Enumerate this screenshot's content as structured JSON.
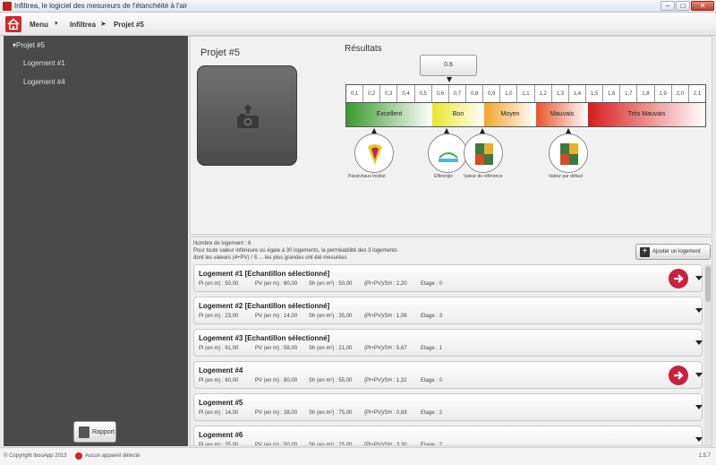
{
  "window": {
    "title": "Infiltrea, le logiciel des mesureurs de l'étanchéité à l'air",
    "btn_min": "–",
    "btn_max": "□",
    "btn_close": "✕"
  },
  "menubar": {
    "menu_label": "Menu",
    "menu_caret": "▾",
    "crumbs": [
      "Infiltrea",
      "Projet #5"
    ],
    "crumb_sep": "➤"
  },
  "sidebar": {
    "root": "▾Projet #5",
    "items": [
      "Logement #1",
      "Logement #4"
    ],
    "rapport_label": "Rapport"
  },
  "project": {
    "title": "Projet #5"
  },
  "results": {
    "title": "Résultats",
    "value": "0.6",
    "ticks": [
      "0,1",
      "0,2",
      "0,3",
      "0,4",
      "0,5",
      "0,6",
      "0,7",
      "0,8",
      "0,9",
      "1,0",
      "1,1",
      "1,2",
      "1,3",
      "1,4",
      "1,5",
      "1,6",
      "1,7",
      "1,8",
      "1,9",
      "2,0",
      "2,1"
    ],
    "zones": [
      {
        "label": "Excellent",
        "color": "#3a9a2e"
      },
      {
        "label": "Bon",
        "color": "#e9e52a"
      },
      {
        "label": "Moyen",
        "color": "#f2a52a"
      },
      {
        "label": "Mauvais",
        "color": "#e8552a"
      },
      {
        "label": "Très Mauvais",
        "color": "#d81c1c"
      }
    ],
    "badges": [
      {
        "label": "Passivhaus Institut"
      },
      {
        "label": "Effinergie"
      },
      {
        "label": "Valeur de référence"
      },
      {
        "label": "Valeur par défaut"
      }
    ]
  },
  "list": {
    "count_line": "Nombre de logement : 6",
    "info_line1": "Pour toute valeur inférieure ou égale à 30 logements, la perméabilité des 3 logements",
    "info_line2": "dont les valeurs (4+PV) / S ... les plus grandes ont été mesurées",
    "add_label": "Ajouter un logement",
    "field_labels": [
      "Pl (en m) :",
      "PV (en m) :",
      "Sh (en m²) :",
      "(Pl+PV)/SH :",
      "Etage :"
    ],
    "items": [
      {
        "name": "Logement #1 [Echantillon sélectionné]",
        "pl": "50,00",
        "pv": "60,00",
        "sh": "50,00",
        "ratio": "2,20",
        "etage": "0",
        "go": true
      },
      {
        "name": "Logement #2 [Echantillon sélectionné]",
        "pl": "23,00",
        "pv": "14,00",
        "sh": "35,00",
        "ratio": "1,06",
        "etage": "3",
        "go": false
      },
      {
        "name": "Logement #3 [Echantillon sélectionné]",
        "pl": "61,00",
        "pv": "58,00",
        "sh": "21,00",
        "ratio": "5,67",
        "etage": "1",
        "go": false
      },
      {
        "name": "Logement #4",
        "pl": "60,00",
        "pv": "80,00",
        "sh": "55,00",
        "ratio": "1,32",
        "etage": "0",
        "go": true
      },
      {
        "name": "Logement #5",
        "pl": "14,00",
        "pv": "38,00",
        "sh": "75,00",
        "ratio": "0,69",
        "etage": "2",
        "go": false
      },
      {
        "name": "Logement #6",
        "pl": "35,00",
        "pv": "50,00",
        "sh": "25,00",
        "ratio": "3,30",
        "etage": "2",
        "go": false
      }
    ]
  },
  "footer": {
    "copyright": "© Copyright ibooApp 2013",
    "status": "Aucun appareil détecté",
    "version": "1.5.7"
  }
}
